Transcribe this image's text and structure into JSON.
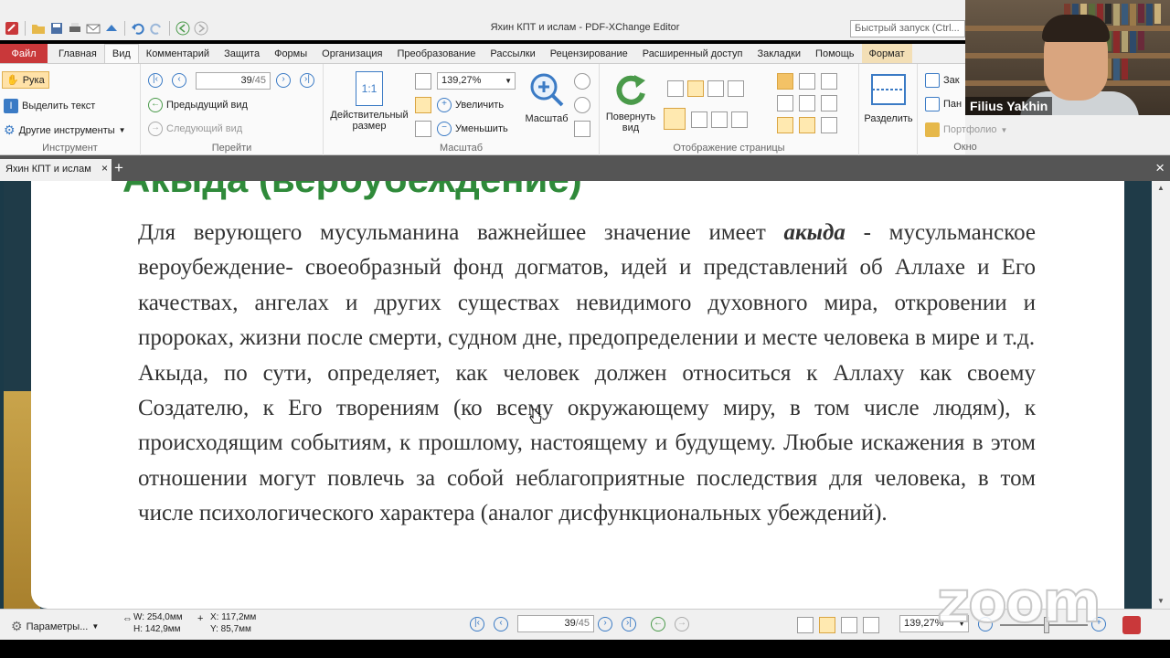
{
  "window": {
    "title": "Яхин КПТ и ислам - PDF-XChange Editor",
    "quick_launch_placeholder": "Быстрый запуск (Ctrl..."
  },
  "ribbon_tabs": [
    "Файл",
    "Главная",
    "Вид",
    "Комментарий",
    "Защита",
    "Формы",
    "Организация",
    "Преобразование",
    "Рассылки",
    "Рецензирование",
    "Расширенный доступ",
    "Закладки",
    "Помощь",
    "Формат"
  ],
  "ribbon": {
    "tool_group": {
      "hand": "Рука",
      "select_text": "Выделить текст",
      "other_tools": "Другие инструменты",
      "label": "Инструмент"
    },
    "goto_group": {
      "page_value": "39",
      "page_total": "/45",
      "prev_view": "Предыдущий вид",
      "next_view": "Следующий вид",
      "label": "Перейти"
    },
    "zoom_group": {
      "actual_size": "Действительный размер",
      "actual_icon_text": "1:1",
      "zoom_value": "139,27%",
      "zoom_in": "Увеличить",
      "zoom_out": "Уменьшить",
      "zoom_tool": "Масштаб",
      "label": "Масштаб"
    },
    "page_display_group": {
      "rotate": "Повернуть вид",
      "label": "Отображение страницы"
    },
    "split": "Разделить",
    "window_group": {
      "item1": "Зак",
      "item2": "Пан",
      "portfolio": "Портфолио",
      "label": "Окно"
    }
  },
  "webcam": {
    "name": "Filius Yakhin"
  },
  "doc_tab": {
    "title": "Яхин КПТ и ислам",
    "close": "×",
    "new_tab": "+",
    "close_all": "×"
  },
  "document": {
    "heading": "Акыда (вероубеждение)",
    "para1_start": "Для верующего мусульманина важнейшее значение имеет ",
    "para1_bold": "акыда",
    "para1_rest": " - мусульманское вероубеждение-  своеобразный фонд догматов, идей и представлений об Аллахе и Его качествах, ангелах и других существах невидимого духовного мира, откровении и пророках, жизни после смерти, судном дне, предопределении и месте человека в мире и т.д.",
    "para2": "Акыда, по сути, определяет, как человек должен относиться к  Аллаху как своему Создателю, к Его творениям (ко всему окружающему миру, в том числе людям), к происходящим событиям, к прошлому, настоящему и будущему. Любые искажения в этом отношении могут повлечь за собой неблагоприятные последствия для человека, в том числе психологического характера (аналог дисфункциональных убеждений)."
  },
  "statusbar": {
    "params": "Параметры...",
    "width": "W: 254,0мм",
    "height": "H: 142,9мм",
    "x": "X: 117,2мм",
    "y": "Y:   85,7мм",
    "page_value": "39",
    "page_total": "/45",
    "zoom_value": "139,27%"
  },
  "watermark": "zoom",
  "colors": {
    "file_tab": "#c9383a",
    "heading_green": "#2f8a3a",
    "slide_dark": "#1f3b48",
    "slide_gold": "#c9a44b"
  }
}
